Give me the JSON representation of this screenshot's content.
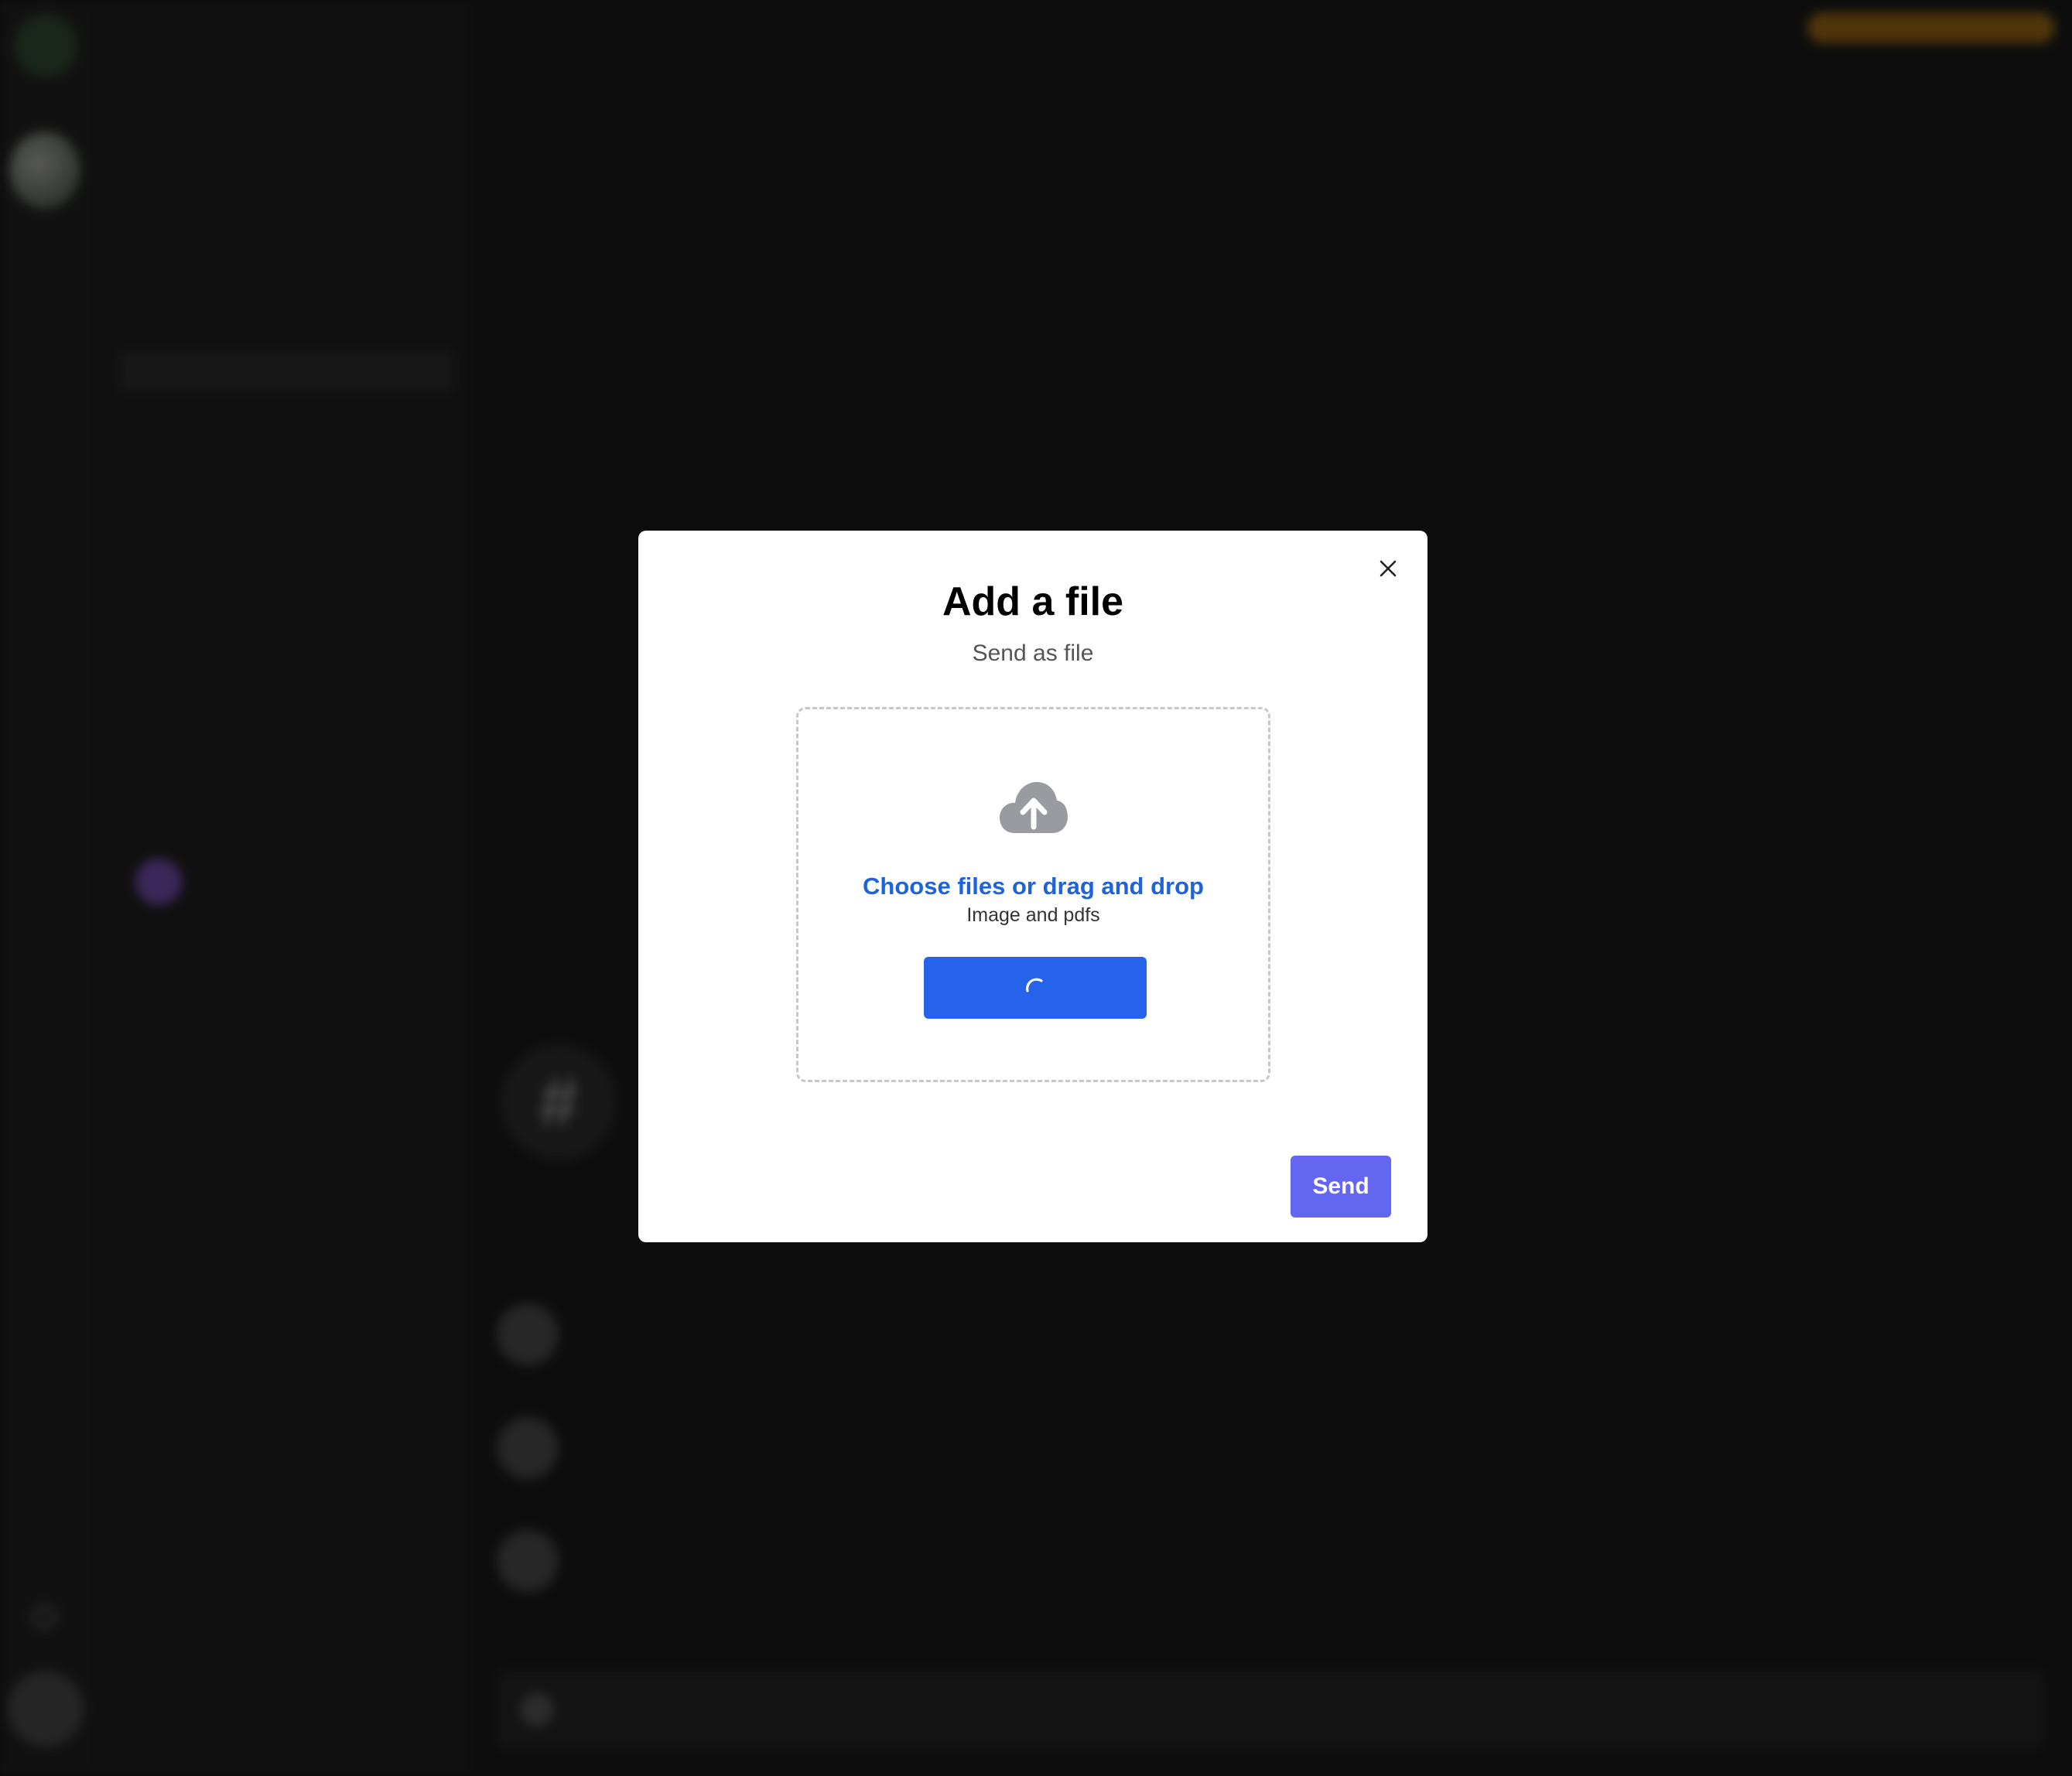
{
  "modal": {
    "title": "Add a file",
    "subtitle": "Send as file",
    "dropzone": {
      "icon": "cloud-upload-icon",
      "choose_label": "Choose files or drag and drop",
      "accepted_types": "Image and pdfs",
      "upload_button_state": "loading",
      "upload_button_icon": "spinner-icon"
    },
    "send_label": "Send",
    "close_icon": "close-icon"
  },
  "colors": {
    "link": "#1e63d8",
    "upload_button": "#2563eb",
    "send_button": "#6366f1"
  }
}
